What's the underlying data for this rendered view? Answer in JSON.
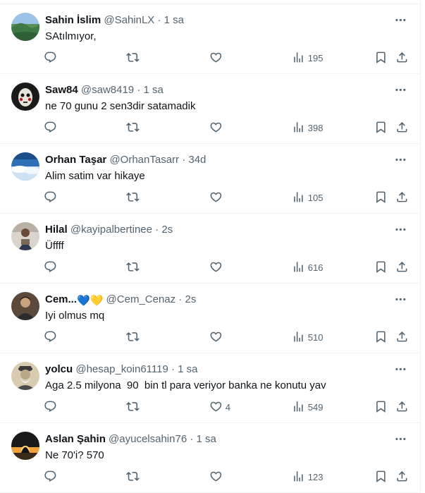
{
  "tweets": [
    {
      "name": "Sahin İslim",
      "emoji": "",
      "handle": "@SahinLX",
      "dot": "·",
      "time": "1 sa",
      "text": "SAtılmıyor,",
      "likes": "",
      "views": "195",
      "avatar": "landscape-hill-avatar"
    },
    {
      "name": "Saw84",
      "emoji": "",
      "handle": "@saw8419",
      "dot": "·",
      "time": "1 sa",
      "text": "ne 70 gunu 2 sen3dir satamadik",
      "likes": "",
      "views": "398",
      "avatar": "mask-face-avatar"
    },
    {
      "name": "Orhan Taşar",
      "emoji": "",
      "handle": "@OrhanTasarr",
      "dot": "·",
      "time": "34d",
      "text": "Alim satim var hikaye",
      "likes": "",
      "views": "105",
      "avatar": "sky-clouds-avatar"
    },
    {
      "name": "Hilal",
      "emoji": "",
      "handle": "@kayipalbertinee",
      "dot": "·",
      "time": "2s",
      "text": "Üffff",
      "likes": "",
      "views": "616",
      "avatar": "person-photo-avatar"
    },
    {
      "name": "Cem...",
      "emoji": "💙💛",
      "handle": "@Cem_Cenaz",
      "dot": "·",
      "time": "2s",
      "text": "Iyi olmus mq",
      "likes": "",
      "views": "510",
      "avatar": "person-dark-avatar"
    },
    {
      "name": "yolcu",
      "emoji": "",
      "handle": "@hesap_koin61119",
      "dot": "·",
      "time": "1 sa",
      "text": "Aga 2.5 milyona  90  bin tl para veriyor banka ne konutu yav",
      "likes": "4",
      "views": "549",
      "avatar": "old-man-sepia-avatar"
    },
    {
      "name": "Aslan Şahin",
      "emoji": "",
      "handle": "@ayucelsahin76",
      "dot": "·",
      "time": "1 sa",
      "text": "Ne 70'i? 570",
      "likes": "",
      "views": "123",
      "avatar": "sunset-silhouette-avatar"
    }
  ],
  "colors": {
    "text": "#0f1419",
    "secondary": "#536471",
    "border": "#eff3f4"
  },
  "icons": [
    "more-icon",
    "reply-icon",
    "retweet-icon",
    "like-icon",
    "views-icon",
    "bookmark-icon",
    "share-icon"
  ]
}
